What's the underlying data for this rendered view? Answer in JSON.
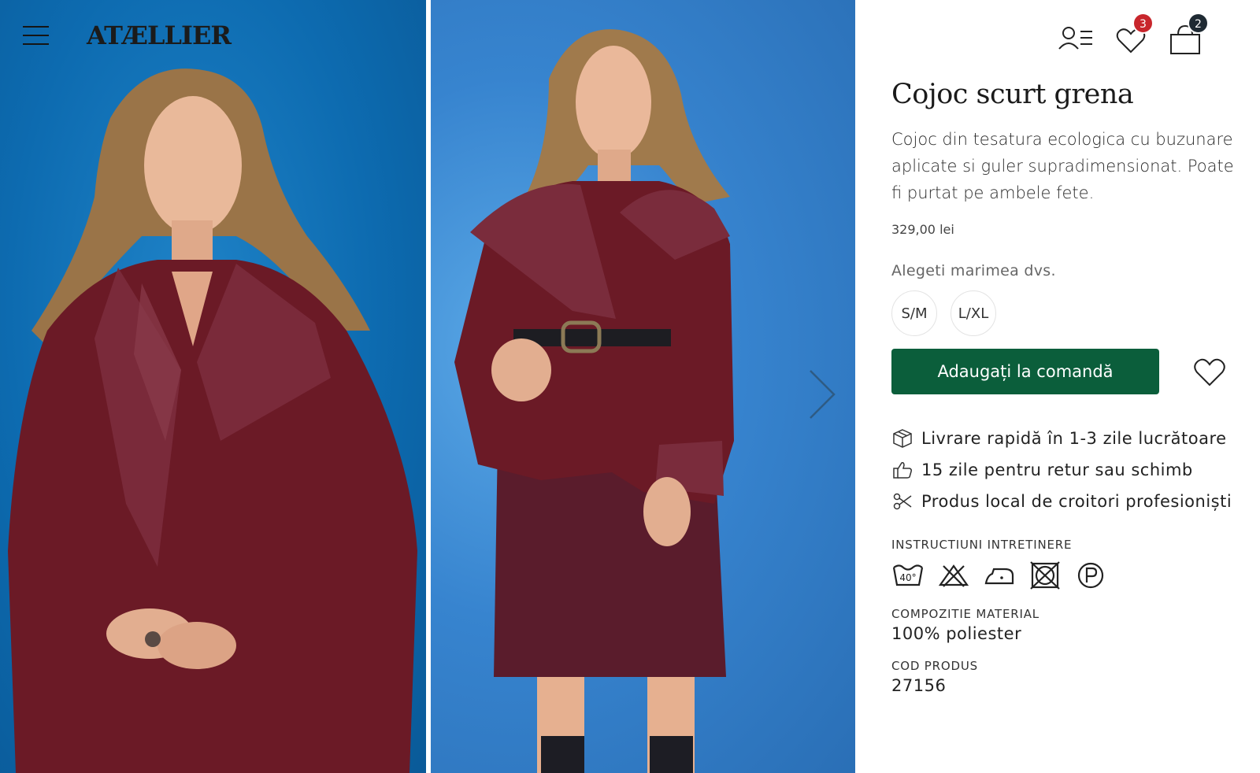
{
  "header": {
    "logo": "ATÆLLIER",
    "wishlist_count": "3",
    "cart_count": "2"
  },
  "product": {
    "title": "Cojoc scurt grena",
    "description": "Cojoc din tesatura ecologica cu buzunare aplicate si guler supradimensionat. Poate fi purtat pe ambele fete.",
    "price": "329,00 lei",
    "size_label": "Alegeti marimea dvs.",
    "sizes": [
      "S/M",
      "L/XL"
    ],
    "add_button": "Adaugați la comandă",
    "features": [
      {
        "icon": "box-icon",
        "text": "Livrare rapidă în 1-3 zile lucrătoare"
      },
      {
        "icon": "thumbs-up-icon",
        "text": "15 zile pentru retur sau schimb"
      },
      {
        "icon": "scissors-icon",
        "text": "Produs local de croitori profesioniști"
      }
    ],
    "care_label": "INSTRUCTIUNI INTRETINERE",
    "care_wash_temp": "40°",
    "composition_label": "COMPOZITIE MATERIAL",
    "composition": "100% poliester",
    "code_label": "COD PRODUS",
    "code": "27156"
  },
  "colors": {
    "accent": "#0b5e3b",
    "badge_red": "#c8262c",
    "badge_dark": "#1f2a33",
    "coat": "#6b1a26"
  }
}
